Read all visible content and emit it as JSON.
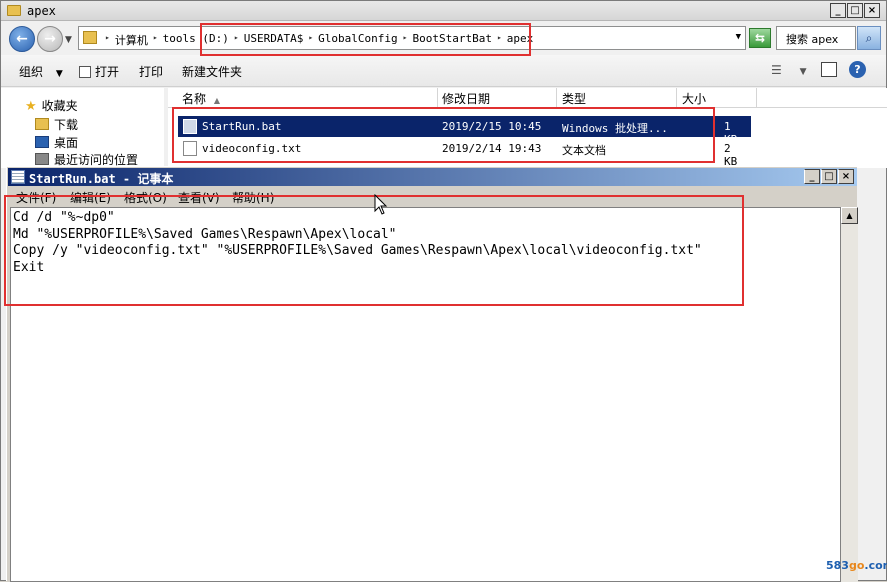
{
  "explorer": {
    "title": "apex",
    "address": {
      "crumbs": [
        "计算机",
        "tools (D:)",
        "USERDATA$",
        "GlobalConfig",
        "BootStartBat",
        "apex"
      ]
    },
    "search_text": "搜索 apex",
    "toolbar": {
      "organize": "组织",
      "open": "打开",
      "print": "打印",
      "new_folder": "新建文件夹"
    },
    "nav": {
      "favorites": "收藏夹",
      "downloads": "下载",
      "desktop": "桌面",
      "recent": "最近访问的位置"
    },
    "columns": {
      "name": "名称",
      "modified": "修改日期",
      "type": "类型",
      "size": "大小"
    },
    "files": [
      {
        "name": "StartRun.bat",
        "modified": "2019/2/15 10:45",
        "type": "Windows 批处理...",
        "size": "1 KB",
        "selected": true
      },
      {
        "name": "videoconfig.txt",
        "modified": "2019/2/14 19:43",
        "type": "文本文档",
        "size": "2 KB",
        "selected": false
      }
    ]
  },
  "notepad": {
    "title": "StartRun.bat - 记事本",
    "menu": {
      "file": "文件(F)",
      "edit": "编辑(E)",
      "format": "格式(O)",
      "view": "查看(V)",
      "help": "帮助(H)"
    },
    "content": "Cd /d \"%~dp0\"\nMd \"%USERPROFILE%\\Saved Games\\Respawn\\Apex\\local\"\nCopy /y \"videoconfig.txt\" \"%USERPROFILE%\\Saved Games\\Respawn\\Apex\\local\\videoconfig.txt\"\nExit"
  },
  "watermark": {
    "text_a": "583",
    "text_b": "go",
    "text_c": ".com"
  },
  "colors": {
    "highlight_box": "#e03030",
    "selection": "#0a246a",
    "titlebar_start": "#0a246a",
    "titlebar_end": "#a6caf0"
  }
}
